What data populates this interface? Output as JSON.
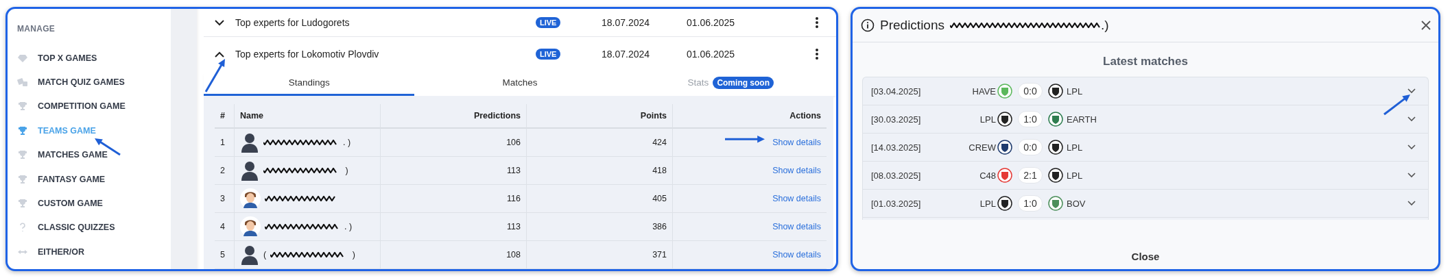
{
  "sidebar": {
    "heading": "MANAGE",
    "items": [
      {
        "label": "TOP X GAMES",
        "selected": false
      },
      {
        "label": "MATCH QUIZ GAMES",
        "selected": false
      },
      {
        "label": "COMPETITION GAME",
        "selected": false
      },
      {
        "label": "TEAMS GAME",
        "selected": true
      },
      {
        "label": "MATCHES GAME",
        "selected": false
      },
      {
        "label": "FANTASY GAME",
        "selected": false
      },
      {
        "label": "CUSTOM GAME",
        "selected": false
      },
      {
        "label": "CLASSIC QUIZZES",
        "selected": false
      },
      {
        "label": "EITHER/OR",
        "selected": false
      }
    ]
  },
  "games": [
    {
      "title": "Top experts for Ludogorets",
      "status": "LIVE",
      "start": "18.07.2024",
      "end": "01.06.2025",
      "expanded": false
    },
    {
      "title": "Top experts for Lokomotiv Plovdiv",
      "status": "LIVE",
      "start": "18.07.2024",
      "end": "01.06.2025",
      "expanded": true
    }
  ],
  "tabs": [
    {
      "label": "Standings",
      "selected": true,
      "disabled": false
    },
    {
      "label": "Matches",
      "selected": false,
      "disabled": false
    },
    {
      "label": "Stats",
      "selected": false,
      "disabled": true,
      "badge": "Coming soon"
    }
  ],
  "table": {
    "columns": [
      "#",
      "Name",
      "Predictions",
      "Points",
      "Actions"
    ],
    "rows": [
      {
        "rank": "1",
        "kind": "silhouette",
        "name_suffix": ". )",
        "predictions": "106",
        "points": "424",
        "action": "Show details"
      },
      {
        "rank": "2",
        "kind": "silhouette",
        "name_suffix": " )",
        "predictions": "113",
        "points": "418",
        "action": "Show details"
      },
      {
        "rank": "3",
        "kind": "person",
        "predictions": "116",
        "points": "405",
        "action": "Show details"
      },
      {
        "rank": "4",
        "kind": "person",
        "name_suffix": ". )",
        "predictions": "113",
        "points": "386",
        "action": "Show details"
      },
      {
        "rank": "5",
        "kind": "silhouette",
        "name_prefix": "(",
        "name_suffix": " )",
        "predictions": "108",
        "points": "371",
        "action": "Show details"
      }
    ]
  },
  "dialog": {
    "title": "Predictions",
    "title_suffix": ".)",
    "section": "Latest matches",
    "close": "Close",
    "matches": [
      {
        "date": "[03.04.2025]",
        "home": {
          "name": "HAVE",
          "color": "#5cb85c"
        },
        "score": "0:0",
        "away": {
          "name": "LPL",
          "color": "#222222"
        }
      },
      {
        "date": "[30.03.2025]",
        "home": {
          "name": "LPL",
          "color": "#222222"
        },
        "score": "1:0",
        "away": {
          "name": "EARTH",
          "color": "#2e7d4f"
        }
      },
      {
        "date": "[14.03.2025]",
        "home": {
          "name": "CREW",
          "color": "#1f3b6e"
        },
        "score": "0:0",
        "away": {
          "name": "LPL",
          "color": "#222222"
        }
      },
      {
        "date": "[08.03.2025]",
        "home": {
          "name": "C48",
          "color": "#e53935"
        },
        "score": "2:1",
        "away": {
          "name": "LPL",
          "color": "#222222"
        }
      },
      {
        "date": "[01.03.2025]",
        "home": {
          "name": "LPL",
          "color": "#222222"
        },
        "score": "1:0",
        "away": {
          "name": "BOV",
          "color": "#4c8f5a"
        }
      }
    ]
  }
}
